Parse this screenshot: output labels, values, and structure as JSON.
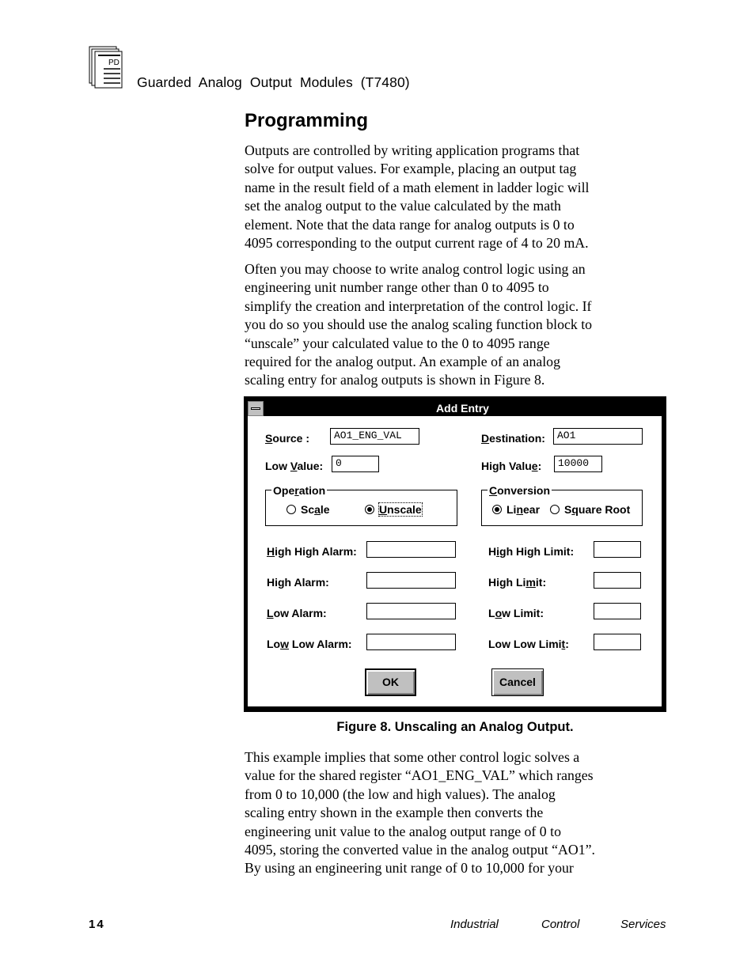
{
  "header": {
    "logo_text": "PD",
    "title": "Guarded Analog Output Modules (T7480)"
  },
  "section": {
    "title": "Programming"
  },
  "paragraphs": [
    {
      "lines": [
        "Outputs are controlled by writing application programs that",
        "solve for output values.  For example, placing an output tag",
        "name in the result field of a math element in ladder logic will",
        "set the analog output to the value calculated by the math",
        "element.  Note that the data range for analog outputs is 0 to",
        "4095 corresponding to the output current rage of 4 to 20 mA."
      ]
    },
    {
      "lines": [
        "Often you may choose to write analog control logic using an",
        "engineering unit number range other than 0 to 4095 to",
        "simplify the creation and interpretation of the control logic.  If",
        "you do so you should use the analog scaling function block to",
        "“unscale” your calculated value to the 0 to 4095 range",
        "required for the analog output.  An example of an analog",
        "scaling entry for analog outputs is shown in Figure 8."
      ]
    },
    {
      "lines": [
        "This example implies that some other control logic solves a",
        "value for the shared register “AO1_ENG_VAL” which ranges",
        "from 0 to 10,000 (the low and high values).  The analog",
        "scaling entry shown in the example then converts the",
        "engineering unit value to the analog output range of 0 to",
        "4095, storing the converted value in the analog output “AO1”.",
        "By using an engineering unit range of 0 to 10,000 for your"
      ]
    }
  ],
  "dialog": {
    "title": "Add Entry",
    "sysmenu_icon": "system-menu-icon",
    "source": {
      "label_pre": "",
      "label_mnemonic": "S",
      "label_post": "ource :",
      "value": "AO1_ENG_VAL"
    },
    "destination": {
      "label_pre": "",
      "label_mnemonic": "D",
      "label_post": "estination:",
      "value": "AO1"
    },
    "low_value": {
      "label_pre": "Low ",
      "label_mnemonic": "V",
      "label_post": "alue:",
      "value": "0"
    },
    "high_value": {
      "label_pre": "High Valu",
      "label_mnemonic": "e",
      "label_post": ":",
      "value": "10000"
    },
    "operation": {
      "legend_pre": "Ope",
      "legend_mnemonic": "r",
      "legend_post": "ation",
      "options": [
        {
          "pre": "Sc",
          "mnemonic": "a",
          "post": "le",
          "selected": false
        },
        {
          "pre": "",
          "mnemonic": "U",
          "post": "nscale",
          "selected": true
        }
      ]
    },
    "conversion": {
      "legend_pre": "",
      "legend_mnemonic": "C",
      "legend_post": "onversion",
      "options": [
        {
          "pre": "Li",
          "mnemonic": "n",
          "post": "ear",
          "selected": true
        },
        {
          "pre": "S",
          "mnemonic": "q",
          "post": "uare Root",
          "selected": false
        }
      ]
    },
    "alarms": [
      {
        "pre": "",
        "mnemonic": "H",
        "post": "igh High Alarm:",
        "value": ""
      },
      {
        "pre": "High Alarm:",
        "mnemonic": "",
        "post": "",
        "value": ""
      },
      {
        "pre": "",
        "mnemonic": "L",
        "post": "ow Alarm:",
        "value": ""
      },
      {
        "pre": "Lo",
        "mnemonic": "w",
        "post": " Low Alarm:",
        "value": ""
      }
    ],
    "limits": [
      {
        "pre": "H",
        "mnemonic": "i",
        "post": "gh High Limit:",
        "value": ""
      },
      {
        "pre": "High Li",
        "mnemonic": "m",
        "post": "it:",
        "value": ""
      },
      {
        "pre": "L",
        "mnemonic": "o",
        "post": "w Limit:",
        "value": ""
      },
      {
        "pre": "Low Low Limi",
        "mnemonic": "t",
        "post": ":",
        "value": ""
      }
    ],
    "ok_label": "OK",
    "cancel_label": "Cancel"
  },
  "caption": "Figure 8.  Unscaling an Analog Output.",
  "footer": {
    "page_number": "14",
    "org_words": [
      "Industrial",
      "Control",
      "Services"
    ]
  }
}
